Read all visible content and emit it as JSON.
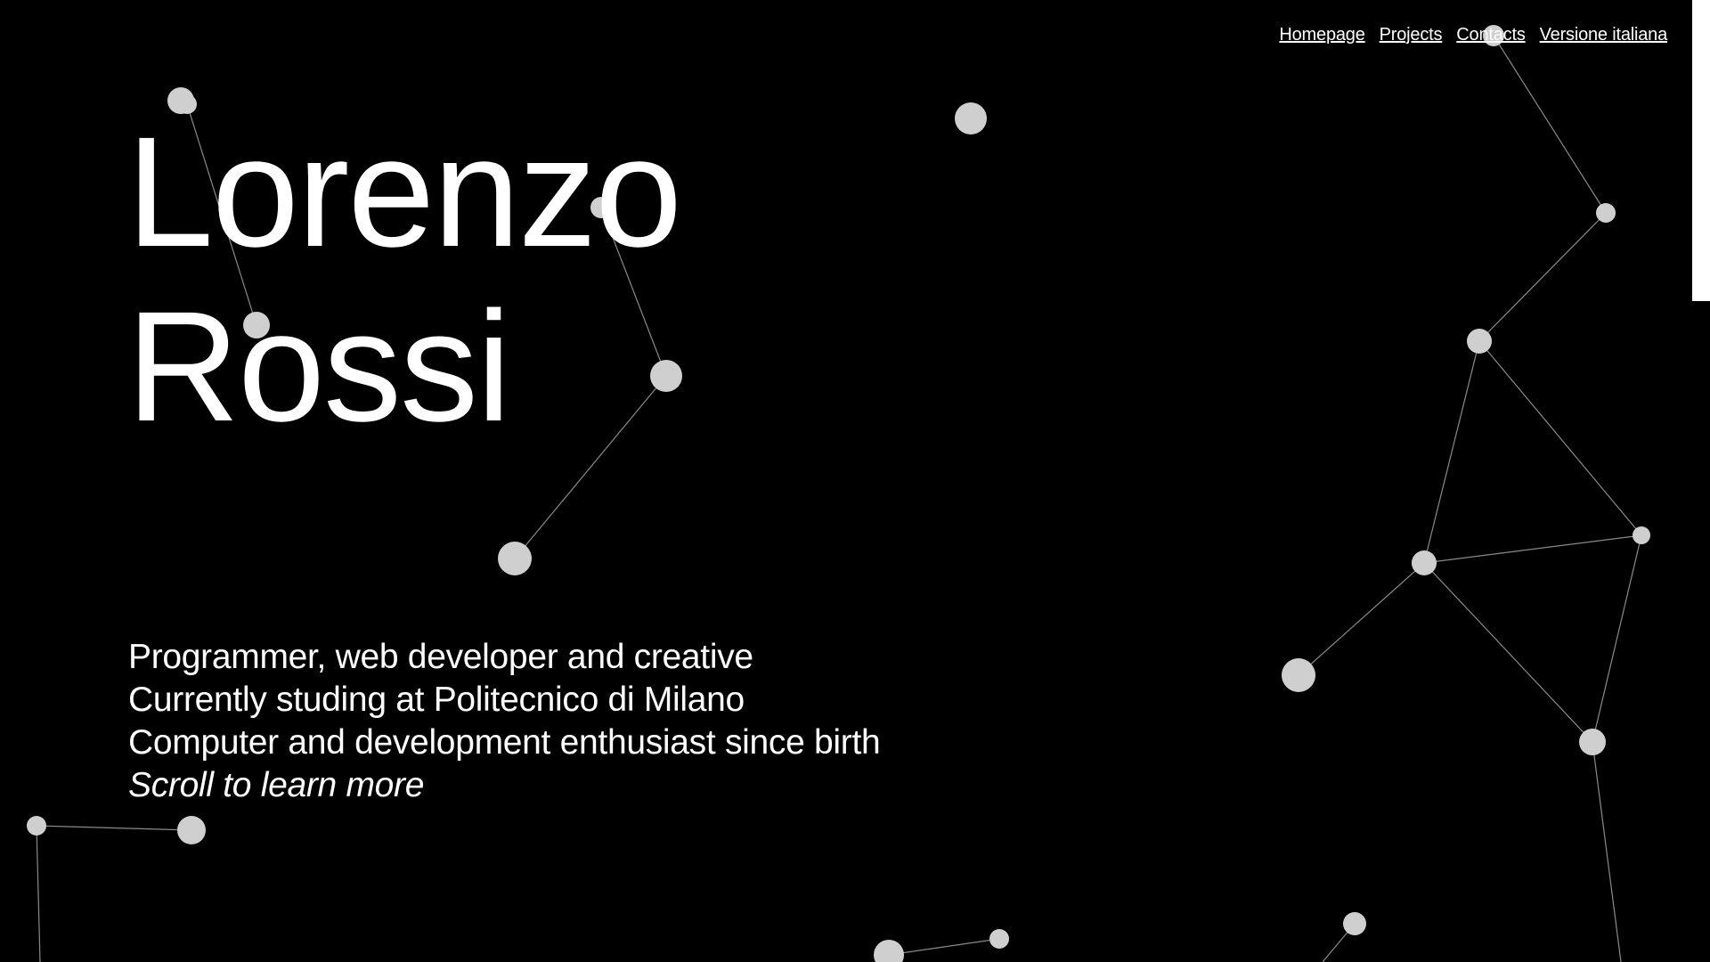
{
  "nav": {
    "homepage": "Homepage",
    "projects": "Projects",
    "contacts": "Contacts",
    "italian": "Versione italiana"
  },
  "hero": {
    "first_name": "Lorenzo",
    "last_name": "Rossi"
  },
  "tagline": {
    "line1": "Programmer, web developer and creative",
    "line2": "Currently studing at Politecnico di Milano",
    "line3": "Computer and development enthusiast since birth",
    "scroll": "Scroll to learn more"
  },
  "colors": {
    "background": "#000000",
    "text": "#ffffff",
    "node": "#cfcfcf",
    "link": "#8a8a8a"
  }
}
